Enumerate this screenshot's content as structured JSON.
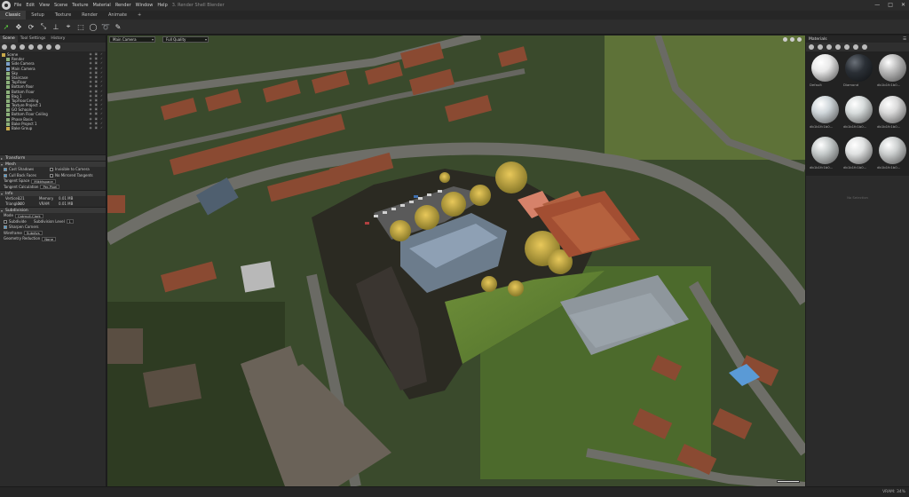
{
  "app": {
    "title": "3. Render Shell Blender",
    "menu": [
      "File",
      "Edit",
      "View",
      "Scene",
      "Texture",
      "Material",
      "Render",
      "Window",
      "Help"
    ],
    "window_controls": [
      "—",
      "□",
      "✕"
    ]
  },
  "mode_tabs": [
    "Classic",
    "Setup",
    "Texture",
    "Render",
    "Animate",
    "+"
  ],
  "left_panel": {
    "tabs": [
      "Scene",
      "Tool Settings",
      "History"
    ],
    "tree": [
      {
        "label": "Scene",
        "kind": "fld",
        "indent": 0
      },
      {
        "label": "Render",
        "kind": "obj",
        "indent": 1
      },
      {
        "label": "Side Camera",
        "kind": "cam",
        "indent": 1
      },
      {
        "label": "Main Camera",
        "kind": "cam",
        "indent": 1
      },
      {
        "label": "Sky",
        "kind": "obj",
        "indent": 1
      },
      {
        "label": "Staircase",
        "kind": "obj",
        "indent": 1
      },
      {
        "label": "TopFloor",
        "kind": "obj",
        "indent": 1
      },
      {
        "label": "Bottom floor",
        "kind": "obj",
        "indent": 1
      },
      {
        "label": "Bottom Floor",
        "kind": "obj",
        "indent": 1
      },
      {
        "label": "Bag 1",
        "kind": "obj",
        "indent": 1
      },
      {
        "label": "TopFloorCeiling",
        "kind": "obj",
        "indent": 1
      },
      {
        "label": "Texture Project 1",
        "kind": "obj",
        "indent": 1
      },
      {
        "label": "GO Schools",
        "kind": "obj",
        "indent": 1
      },
      {
        "label": "Bottom Floor Ceiling",
        "kind": "obj",
        "indent": 1
      },
      {
        "label": "Phase Basis",
        "kind": "obj",
        "indent": 1
      },
      {
        "label": "Bake Project 1",
        "kind": "obj",
        "indent": 1
      },
      {
        "label": "Bake Group",
        "kind": "fld",
        "indent": 1
      }
    ],
    "row_icons": "◉ ▣ ✓",
    "transform_label": "Transform",
    "mesh": {
      "label": "Mesh",
      "cast_shadows": "Cast Shadows",
      "invisible_camera": "Invisible to Camera",
      "cull_back_faces": "Cull Back Faces",
      "no_mirrored_tangents": "No Mirrored Tangents",
      "tangent_space_label": "Tangent Space",
      "tangent_space_value": "Mikktspace",
      "tangent_calc_label": "Tangent Calculation",
      "tangent_calc_value": "Per-Pixel"
    },
    "info": {
      "label": "Info",
      "vertices_label": "Vertices",
      "vertices_value": "121",
      "memory_label": "Memory",
      "memory_value": "0.01 MB",
      "triangles_label": "Triangles",
      "triangles_value": "200",
      "vram_label": "VRAM",
      "vram_value": "0.01 MB"
    },
    "subdivision": {
      "label": "Subdivision",
      "mode_label": "Mode",
      "mode_value": "Catmull-Clark",
      "subdivide_label": "Subdivide",
      "level_label": "Subdivision Level",
      "level_value": "1",
      "sharpen_label": "Sharpen Corners",
      "wireframe_label": "Wireframe",
      "wireframe_value": "Subdivs",
      "geo_label": "Geometry Reduction",
      "geo_value": "None"
    }
  },
  "viewport": {
    "camera": "Main Camera",
    "quality": "Full Quality"
  },
  "materials": {
    "title": "Materials",
    "items": [
      {
        "label": "Default",
        "color": "#e8e8e8"
      },
      {
        "label": "Diamond",
        "color": "#2a2f35"
      },
      {
        "label": "db1b1fc1b0...",
        "color": "#bdbdbd"
      },
      {
        "label": "db1b1fc1b0...",
        "color": "#cfd6da"
      },
      {
        "label": "db1b1fc1b0...",
        "color": "#d7dcdc"
      },
      {
        "label": "db1b1fc1b0...",
        "color": "#d9d9d9"
      },
      {
        "label": "db1b1fc1b0...",
        "color": "#c6cbcb"
      },
      {
        "label": "db1b1fc1b0...",
        "color": "#e0e2e2"
      },
      {
        "label": "db1b1fc1b0...",
        "color": "#cdd0d0"
      }
    ],
    "no_selection": "No Selection"
  },
  "status": {
    "vram": "VRAM: 34%"
  }
}
